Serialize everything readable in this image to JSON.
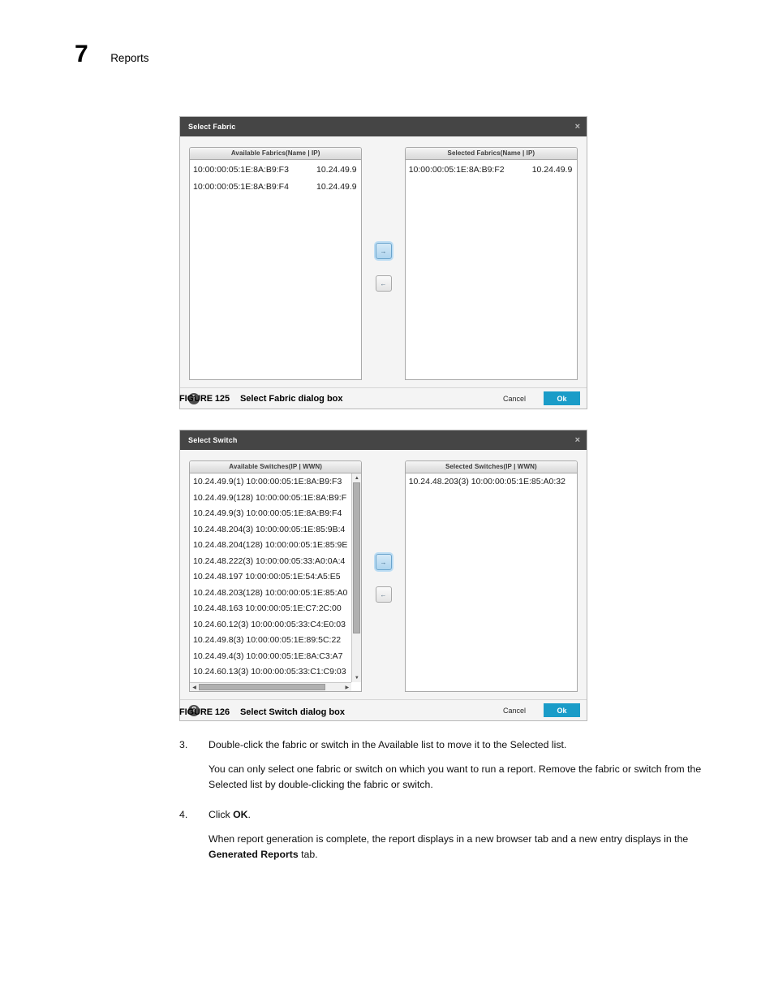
{
  "page": {
    "chapter_number": "7",
    "chapter_title": "Reports"
  },
  "fabric_dialog": {
    "title": "Select Fabric",
    "close_icon": "×",
    "available": {
      "header": "Available Fabrics(Name | IP)",
      "rows": [
        {
          "name": "10:00:00:05:1E:8A:B9:F3",
          "ip": "10.24.49.9"
        },
        {
          "name": "10:00:00:05:1E:8A:B9:F4",
          "ip": "10.24.49.9"
        }
      ]
    },
    "selected": {
      "header": "Selected Fabrics(Name | IP)",
      "rows": [
        {
          "name": "10:00:00:05:1E:8A:B9:F2",
          "ip": "10.24.49.9"
        }
      ]
    },
    "move_right_label": "→",
    "move_left_label": "←",
    "help_label": "?",
    "cancel_label": "Cancel",
    "ok_label": "Ok"
  },
  "switch_dialog": {
    "title": "Select Switch",
    "close_icon": "×",
    "available": {
      "header": "Available Switches(IP | WWN)",
      "rows": [
        "10.24.49.9(1) 10:00:00:05:1E:8A:B9:F3",
        "10.24.49.9(128) 10:00:00:05:1E:8A:B9:F",
        "10.24.49.9(3) 10:00:00:05:1E:8A:B9:F4",
        "10.24.48.204(3) 10:00:00:05:1E:85:9B:4",
        "10.24.48.204(128) 10:00:00:05:1E:85:9E",
        "10.24.48.222(3) 10:00:00:05:33:A0:0A:4",
        "10.24.48.197 10:00:00:05:1E:54:A5:E5",
        "10.24.48.203(128) 10:00:00:05:1E:85:A0",
        "10.24.48.163 10:00:00:05:1E:C7:2C:00",
        "10.24.60.12(3) 10:00:00:05:33:C4:E0:03",
        "10.24.49.8(3) 10:00:00:05:1E:89:5C:22",
        "10.24.49.4(3) 10:00:00:05:1E:8A:C3:A7",
        "10.24.60.13(3) 10:00:00:05:33:C1:C9:03"
      ]
    },
    "selected": {
      "header": "Selected Switches(IP | WWN)",
      "rows": [
        "10.24.48.203(3) 10:00:00:05:1E:85:A0:32"
      ]
    },
    "move_right_label": "→",
    "move_left_label": "←",
    "help_label": "?",
    "cancel_label": "Cancel",
    "ok_label": "Ok",
    "scroll_up_label": "▲",
    "scroll_down_label": "▼",
    "scroll_left_label": "◀",
    "scroll_right_label": "▶"
  },
  "captions": {
    "figure_125_label": "FIGURE 125",
    "figure_125_text": "Select Fabric dialog box",
    "figure_126_label": "FIGURE 126",
    "figure_126_text": "Select Switch dialog box"
  },
  "steps": [
    {
      "number": "3.",
      "text": "Double-click the fabric or switch in the Available list to move it to the Selected list.",
      "paragraph": "You can only select one fabric or switch on which you want to run a report. Remove the fabric or switch from the Selected list by double-clicking the fabric or switch."
    },
    {
      "number": "4.",
      "text_before_bold": "Click ",
      "bold": "OK",
      "text_after_bold": ".",
      "para_before_bold": "When report generation is complete, the report displays in a new browser tab and a new entry displays in the ",
      "para_bold": "Generated Reports",
      "para_after_bold": " tab."
    }
  ]
}
